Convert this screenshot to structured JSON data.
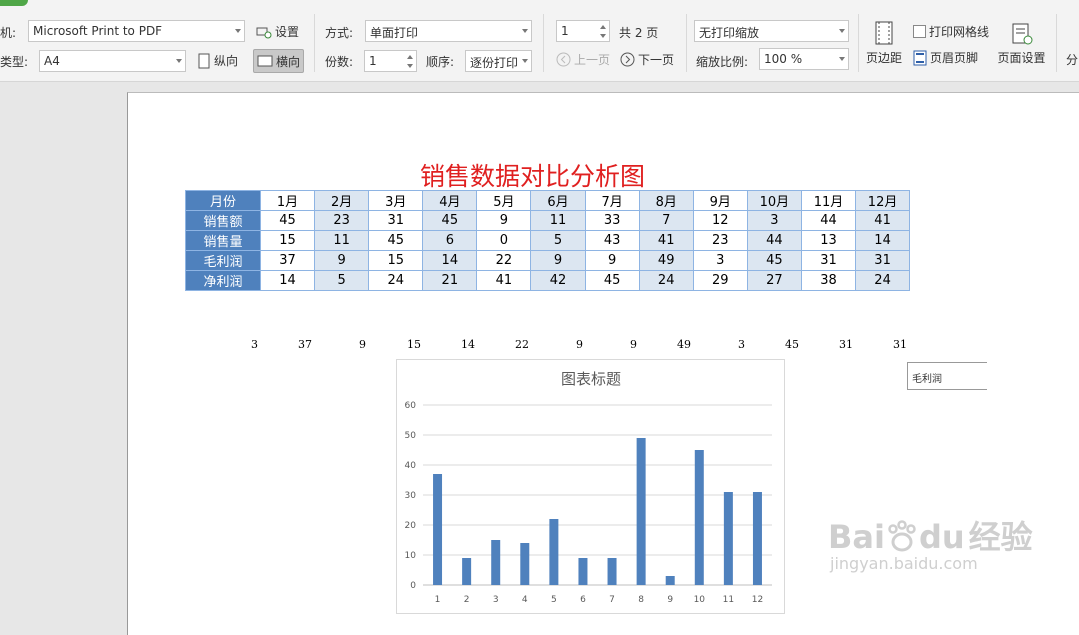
{
  "toolbar": {
    "printer_label": "机:",
    "printer_value": "Microsoft Print to PDF",
    "setup_label": "设置",
    "paper_label": "类型:",
    "paper_value": "A4",
    "portrait_label": "纵向",
    "landscape_label": "横向",
    "mode_label": "方式:",
    "mode_value": "单面打印",
    "copies_label": "份数:",
    "copies_value": "1",
    "order_label": "顺序:",
    "order_value": "逐份打印",
    "page_value": "1",
    "total_pages": "共 2 页",
    "prev_page": "上一页",
    "next_page": "下一页",
    "scale_mode_value": "无打印缩放",
    "zoom_label": "缩放比例:",
    "zoom_value": "100 %",
    "margins_label": "页边距",
    "gridlines_label": "打印网格线",
    "header_footer_label": "页眉页脚",
    "page_setup_label": "页面设置",
    "split_label": "分"
  },
  "sheet": {
    "title": "销售数据对比分析图",
    "table": {
      "header": [
        "月份",
        "1月",
        "2月",
        "3月",
        "4月",
        "5月",
        "6月",
        "7月",
        "8月",
        "9月",
        "10月",
        "11月",
        "12月"
      ],
      "rows": [
        {
          "label": "销售额",
          "values": [
            "45",
            "23",
            "31",
            "45",
            "9",
            "11",
            "33",
            "7",
            "12",
            "3",
            "44",
            "41"
          ]
        },
        {
          "label": "销售量",
          "values": [
            "15",
            "11",
            "45",
            "6",
            "0",
            "5",
            "43",
            "41",
            "23",
            "44",
            "13",
            "14"
          ]
        },
        {
          "label": "毛利润",
          "values": [
            "37",
            "9",
            "15",
            "14",
            "22",
            "9",
            "9",
            "49",
            "3",
            "45",
            "31",
            "31"
          ]
        },
        {
          "label": "净利润",
          "values": [
            "14",
            "5",
            "24",
            "21",
            "41",
            "42",
            "45",
            "24",
            "29",
            "27",
            "38",
            "24"
          ]
        }
      ]
    },
    "stray_row": [
      "3",
      "37",
      "9",
      "15",
      "14",
      "22",
      "9",
      "9",
      "49",
      "3",
      "45",
      "31",
      "31"
    ],
    "legend_cell": "毛利润"
  },
  "chart_data": {
    "type": "bar",
    "title": "图表标题",
    "categories": [
      "1",
      "2",
      "3",
      "4",
      "5",
      "6",
      "7",
      "8",
      "9",
      "10",
      "11",
      "12"
    ],
    "values": [
      37,
      9,
      15,
      14,
      22,
      9,
      9,
      49,
      3,
      45,
      31,
      31
    ],
    "ylim": [
      0,
      60
    ],
    "yticks": [
      "0",
      "10",
      "20",
      "30",
      "40",
      "50",
      "60"
    ],
    "color": "#4f81bd",
    "grid": true
  },
  "watermark": {
    "brand": "Bai",
    "brand2": "du",
    "cn": "经验",
    "url": "jingyan.baidu.com"
  }
}
